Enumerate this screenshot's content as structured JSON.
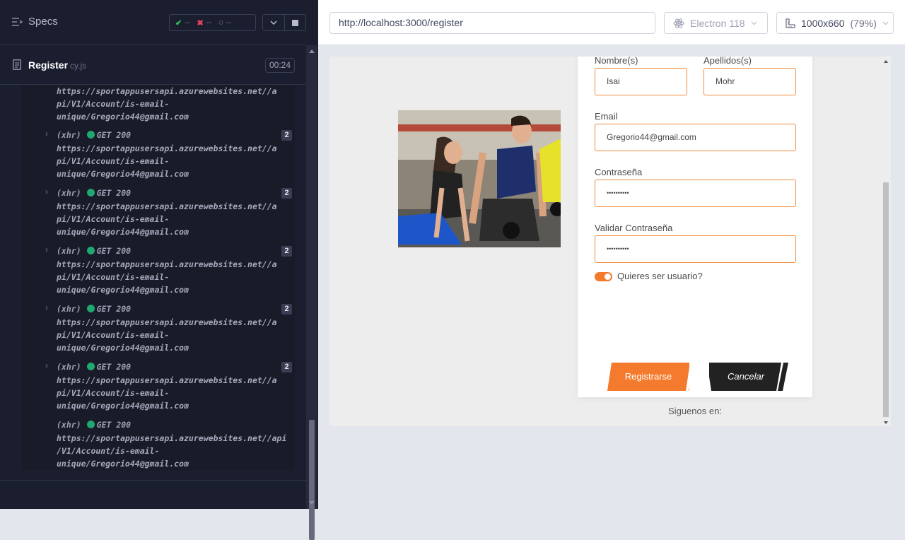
{
  "reporter": {
    "specs_label": "Specs",
    "stats": {
      "passed": "--",
      "failed": "--",
      "pending": "--"
    },
    "spec": {
      "name": "Register",
      "ext": "cy.js",
      "duration": "00:24"
    },
    "log": [
      {
        "partial": true,
        "url": "https://sportappusersapi.azurewebsites.net//a\npi/V1/Account/is-email-\nunique/Gregorio44@gmail.com"
      },
      {
        "type": "(xhr)",
        "method": "GET 200",
        "count": "2",
        "url": "https://sportappusersapi.azurewebsites.net//a\npi/V1/Account/is-email-\nunique/Gregorio44@gmail.com"
      },
      {
        "type": "(xhr)",
        "method": "GET 200",
        "count": "2",
        "url": "https://sportappusersapi.azurewebsites.net//a\npi/V1/Account/is-email-\nunique/Gregorio44@gmail.com"
      },
      {
        "type": "(xhr)",
        "method": "GET 200",
        "count": "2",
        "url": "https://sportappusersapi.azurewebsites.net//a\npi/V1/Account/is-email-\nunique/Gregorio44@gmail.com"
      },
      {
        "type": "(xhr)",
        "method": "GET 200",
        "count": "2",
        "url": "https://sportappusersapi.azurewebsites.net//a\npi/V1/Account/is-email-\nunique/Gregorio44@gmail.com"
      },
      {
        "type": "(xhr)",
        "method": "GET 200",
        "count": "2",
        "url": "https://sportappusersapi.azurewebsites.net//a\npi/V1/Account/is-email-\nunique/Gregorio44@gmail.com"
      },
      {
        "type": "(xhr)",
        "method": "GET 200",
        "count": "",
        "url": "https://sportappusersapi.azurewebsites.net//api\n/V1/Account/is-email-\nunique/Gregorio44@gmail.com"
      }
    ]
  },
  "browser": {
    "url": "http://localhost:3000/register",
    "browser_name": "Electron 118",
    "viewport": "1000x660",
    "viewport_display": "1000x660",
    "zoom": "(79%)"
  },
  "app": {
    "form": {
      "first_name_label": "Nombre(s)",
      "first_name_value": "Isai",
      "last_name_label": "Apellidos(s)",
      "last_name_value": "Mohr",
      "email_label": "Email",
      "email_value": "Gregorio44@gmail.com",
      "password_label": "Contraseña",
      "password_value": "••••••••••",
      "confirm_label": "Validar Contraseña",
      "confirm_value": "••••••••••",
      "toggle_label": "Quieres ser usuario?",
      "toggle_on": true,
      "register_button": "Registrarse",
      "cancel_button": "Cancelar",
      "follow_label": "Siguenos en:",
      "social": [
        "facebook-icon",
        "twitter-icon",
        "google-icon",
        "github-icon"
      ]
    },
    "colors": {
      "accent": "#f47a2d",
      "dark_button": "#222222",
      "social_icon": "#1e6fd9"
    }
  }
}
